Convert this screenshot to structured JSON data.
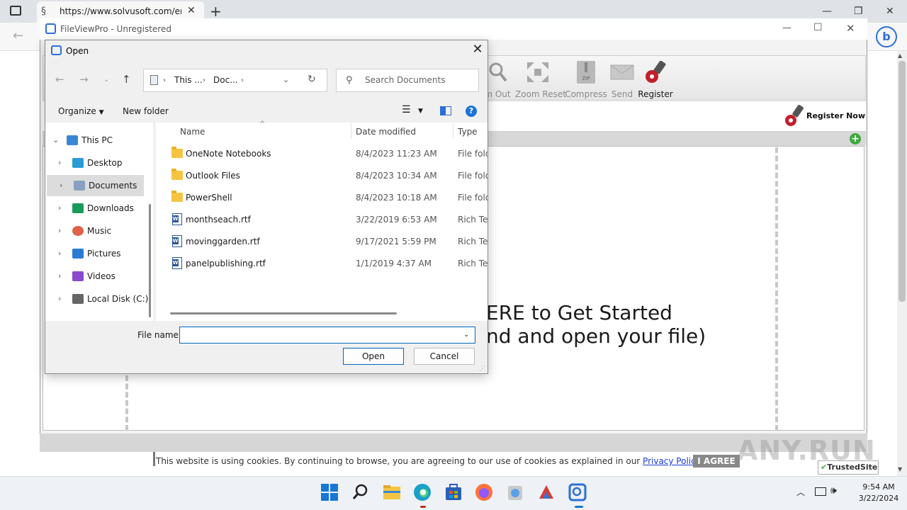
{
  "browser": {
    "tab_url": "https://www.solvusoft.com/en/f",
    "bing_label": "b"
  },
  "app": {
    "title": "FileViewPro - Unregistered",
    "toolbar": {
      "zoom_out": "m Out",
      "zoom_reset": "Zoom Reset",
      "compress": "Compress",
      "send": "Send",
      "register": "Register"
    },
    "register_now": "Register Now",
    "get_started_line1": "ERE to Get Started",
    "get_started_line2": "nd and open your file)"
  },
  "cookie": {
    "text": "This website is using cookies. By continuing to browse, you are agreeing to our use of cookies as explained in our ",
    "link": "Privacy Policy",
    "agree": "I AGREE",
    "trusted": "TrustedSite"
  },
  "dialog": {
    "title": "Open",
    "address": {
      "seg1": "This ...",
      "seg2": "Doc..."
    },
    "search_placeholder": "Search Documents",
    "organize": "Organize",
    "new_folder": "New folder",
    "nav": [
      {
        "label": "This PC",
        "icon": "pc-icon"
      },
      {
        "label": "Desktop",
        "icon": "desktop-icon"
      },
      {
        "label": "Documents",
        "icon": "documents-icon"
      },
      {
        "label": "Downloads",
        "icon": "downloads-icon"
      },
      {
        "label": "Music",
        "icon": "music-icon"
      },
      {
        "label": "Pictures",
        "icon": "pictures-icon"
      },
      {
        "label": "Videos",
        "icon": "videos-icon"
      },
      {
        "label": "Local Disk (C:)",
        "icon": "disk-icon"
      }
    ],
    "columns": {
      "name": "Name",
      "date": "Date modified",
      "type": "Type"
    },
    "files": [
      {
        "name": "OneNote Notebooks",
        "date": "8/4/2023 11:23 AM",
        "type": "File folder",
        "kind": "folder"
      },
      {
        "name": "Outlook Files",
        "date": "8/4/2023 10:34 AM",
        "type": "File folder",
        "kind": "folder"
      },
      {
        "name": "PowerShell",
        "date": "8/4/2023 10:18 AM",
        "type": "File folder",
        "kind": "folder"
      },
      {
        "name": "monthseach.rtf",
        "date": "3/22/2019 6:53 AM",
        "type": "Rich Text",
        "kind": "rtf"
      },
      {
        "name": "movinggarden.rtf",
        "date": "9/17/2021 5:59 PM",
        "type": "Rich Text",
        "kind": "rtf"
      },
      {
        "name": "panelpublishing.rtf",
        "date": "1/1/2019 4:37 AM",
        "type": "Rich Text",
        "kind": "rtf"
      }
    ],
    "file_name_label": "File name:",
    "file_name_value": "",
    "open_button": "Open",
    "cancel_button": "Cancel"
  },
  "taskbar": {
    "time": "9:54 AM",
    "date": "3/22/2024"
  },
  "watermark": "ANY.RUN",
  "colors": {
    "accent": "#0067c0",
    "folder": "#f5c542",
    "success": "#3daa3d"
  }
}
